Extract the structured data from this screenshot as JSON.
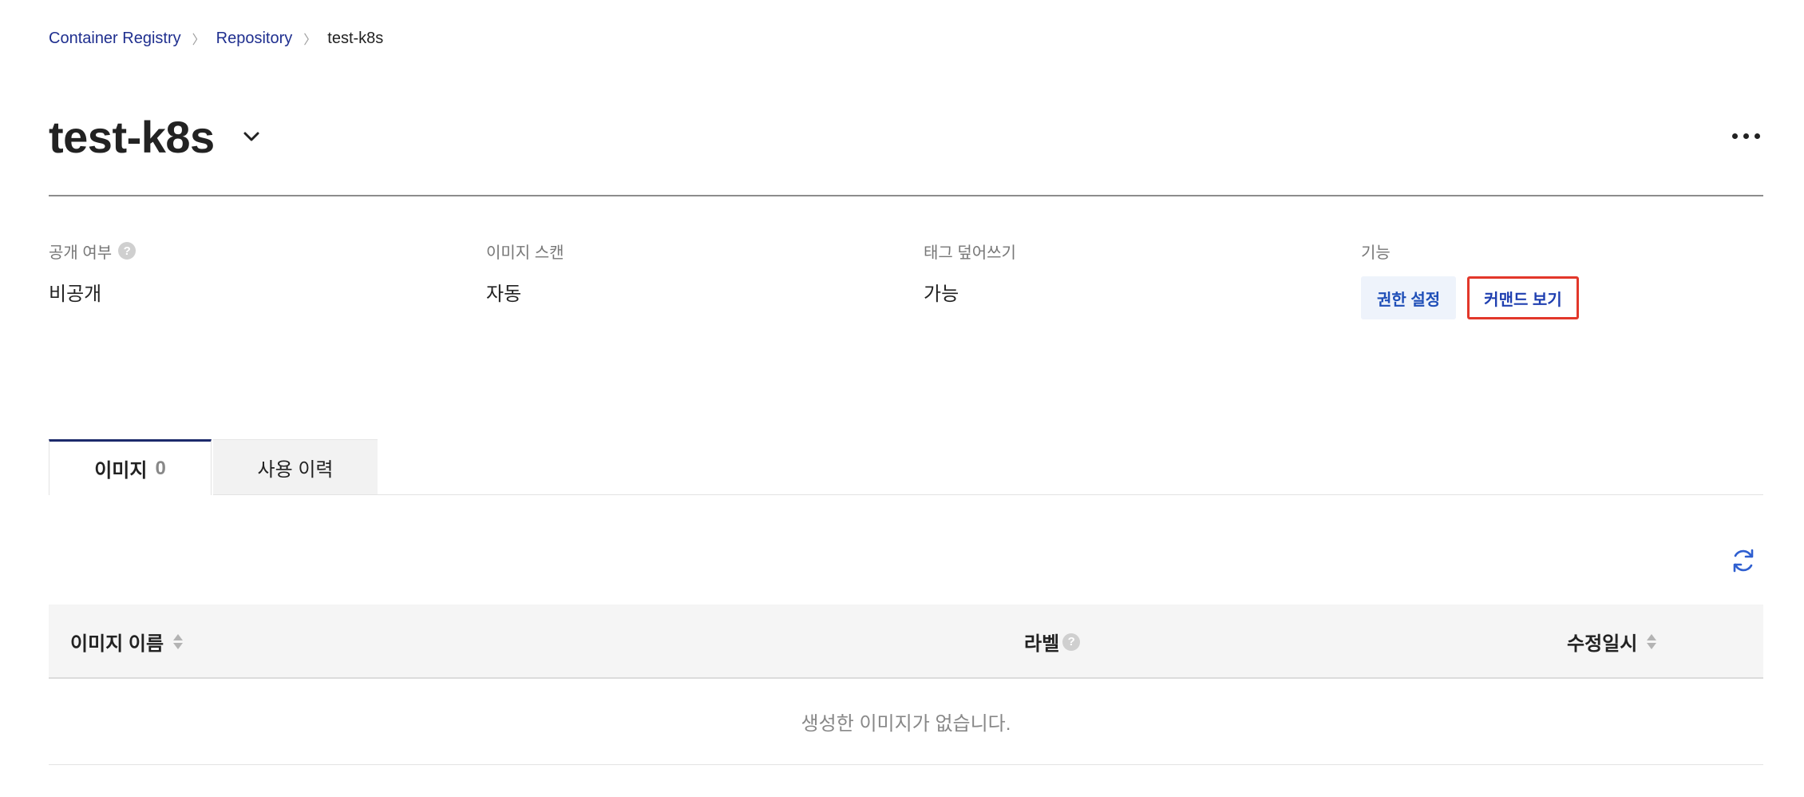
{
  "breadcrumb": {
    "items": [
      "Container Registry",
      "Repository"
    ],
    "current": "test-k8s"
  },
  "header": {
    "title": "test-k8s"
  },
  "info": {
    "visibility_label": "공개 여부",
    "visibility_value": "비공개",
    "scan_label": "이미지 스캔",
    "scan_value": "자동",
    "overwrite_label": "태그 덮어쓰기",
    "overwrite_value": "가능",
    "functions_label": "기능",
    "permission_button": "권한 설정",
    "command_button": "커맨드 보기"
  },
  "tabs": [
    {
      "label": "이미지",
      "count": "0"
    },
    {
      "label": "사용 이력"
    }
  ],
  "table": {
    "columns": [
      "이미지 이름",
      "라벨",
      "수정일시"
    ],
    "empty_message": "생성한 이미지가 없습니다."
  },
  "colors": {
    "link": "#1f2f8f",
    "button_text": "#1f4fb8",
    "button_bg": "#eef3fb",
    "highlight_border": "#e2372a",
    "tab_active_border": "#1c2a6b",
    "refresh_icon": "#2f5fd0"
  },
  "icons": {
    "dropdown": "chevron-down-icon",
    "more": "more-horizontal-icon",
    "help": "help-circle-icon",
    "refresh": "refresh-icon",
    "sort": "sort-icon"
  }
}
